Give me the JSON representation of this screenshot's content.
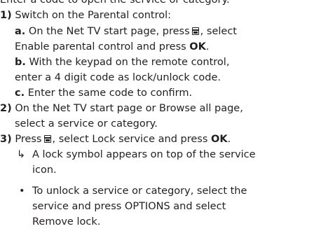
{
  "icons": {
    "options_key": "options-key-icon"
  },
  "intro": "Enter a code to open the service or category.",
  "step1": {
    "num": "1)",
    "title": "Switch on the Parental control:",
    "a": {
      "letter": "a.",
      "text_before": "On the Net TV start page, press",
      "text_after": ", select",
      "line2_before": "Enable parental control and press",
      "ok": "OK",
      "period": "."
    },
    "b": {
      "letter": "b.",
      "line1": "With the keypad on the remote control,",
      "line2": "enter a 4 digit code as lock/unlock code."
    },
    "c": {
      "letter": "c.",
      "text": "Enter the same code to confirm."
    }
  },
  "step2": {
    "num": "2)",
    "line1": "On the Net TV start page or Browse all page,",
    "line2": "select a service or category."
  },
  "step3": {
    "num": "3)",
    "text_before": "Press",
    "text_middle": ", select Lock service and press",
    "ok": "OK",
    "period": ".",
    "result": {
      "arrow": "↳",
      "line1": "A lock symbol appears on top of the service",
      "line2": "icon."
    },
    "bullet": {
      "mark": "•",
      "line1": "To unlock a service or category, select the",
      "line2": "service and press OPTIONS and select",
      "line3": "Remove lock."
    }
  }
}
